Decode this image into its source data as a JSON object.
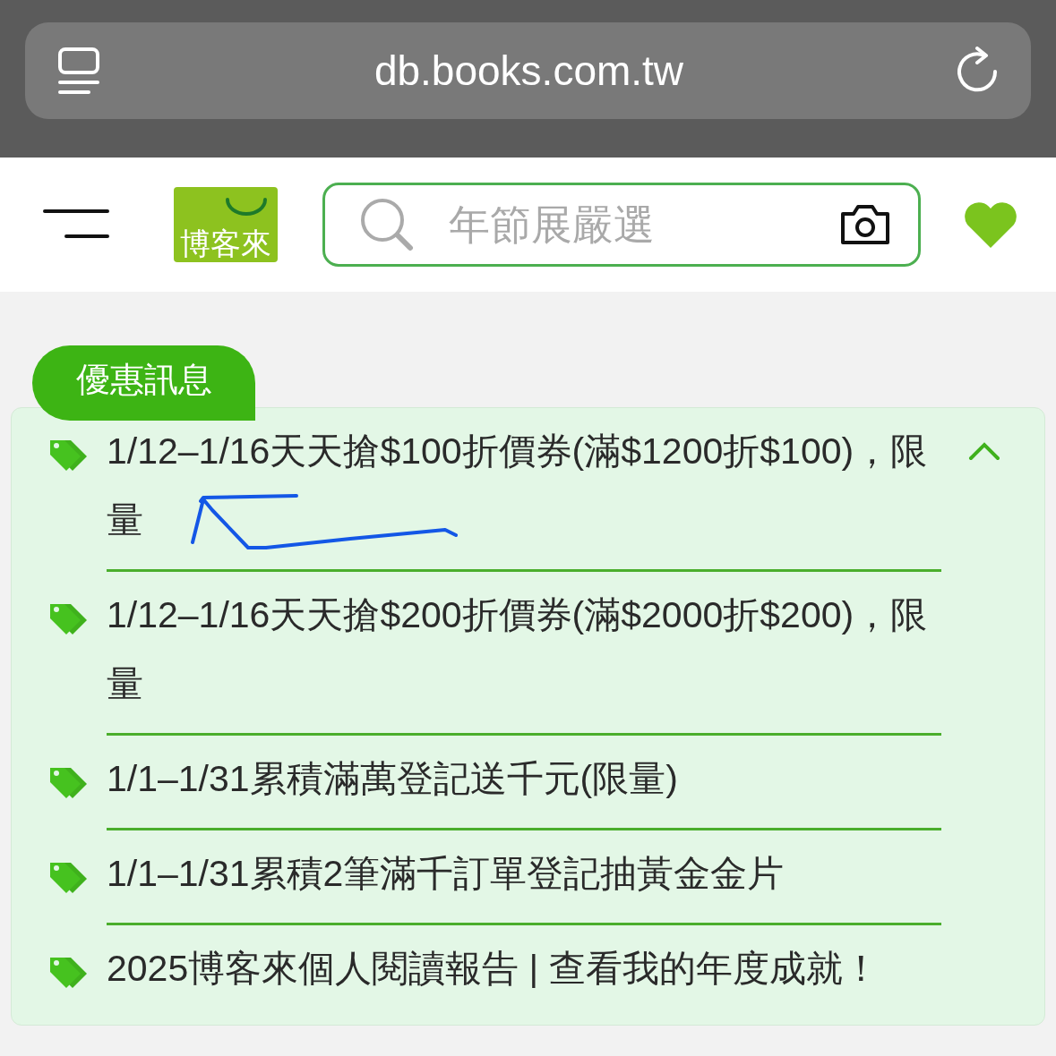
{
  "browser": {
    "url": "db.books.com.tw"
  },
  "header": {
    "logo": "博客來",
    "search": {
      "placeholder": "年節展嚴選"
    }
  },
  "promotions": {
    "title": "優惠訊息",
    "expanded": true,
    "items": [
      {
        "text": "1/12–1/16天天搶$100折價券(滿$1200折$100)，限量"
      },
      {
        "text": "1/12–1/16天天搶$200折價券(滿$2000折$200)，限量"
      },
      {
        "text": "1/1–1/31累積滿萬登記送千元(限量)"
      },
      {
        "text": "1/1–1/31累積2筆滿千訂單登記抽黃金金片"
      },
      {
        "text": "2025博客來個人閱讀報告 | 查看我的年度成就！"
      }
    ]
  }
}
